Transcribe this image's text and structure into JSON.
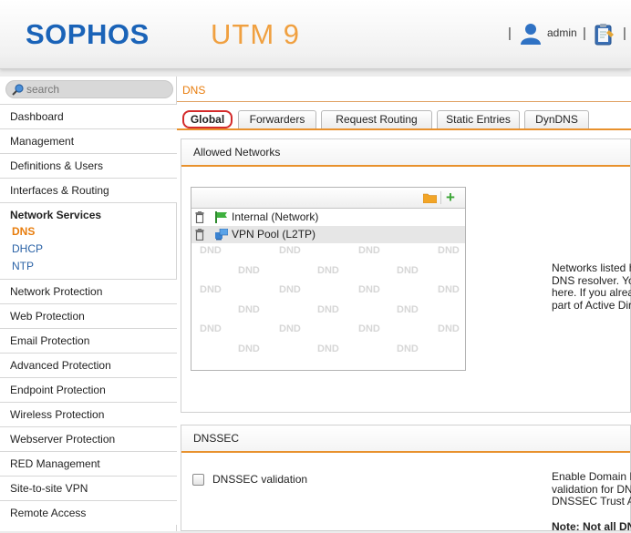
{
  "header": {
    "logo": "SOPHOS",
    "product": "UTM 9",
    "user_name": "admin",
    "separator": "|"
  },
  "search": {
    "placeholder": "search"
  },
  "sidebar": {
    "items_before": [
      "Dashboard",
      "Management",
      "Definitions & Users",
      "Interfaces & Routing"
    ],
    "group": {
      "title": "Network Services",
      "items": [
        "DNS",
        "DHCP",
        "NTP"
      ],
      "active": "DNS"
    },
    "items_after": [
      "Network Protection",
      "Web Protection",
      "Email Protection",
      "Advanced Protection",
      "Endpoint Protection",
      "Wireless Protection",
      "Webserver Protection",
      "RED Management",
      "Site-to-site VPN",
      "Remote Access"
    ]
  },
  "breadcrumb": "DNS",
  "tabs": [
    "Global",
    "Forwarders",
    "Request Routing",
    "Static Entries",
    "DynDNS"
  ],
  "active_tab": "Global",
  "allowed_networks": {
    "title": "Allowed Networks",
    "entries": [
      "Internal (Network)",
      "VPN Pool (L2TP)"
    ],
    "dnd_text": "DND",
    "help_lines": [
      "Networks listed h",
      "DNS resolver. Yo",
      "here. If you alrea",
      "part of Active Dir"
    ]
  },
  "dnssec": {
    "title": "DNSSEC",
    "checkbox_label": "DNSSEC validation",
    "checked": false,
    "help_lines": [
      "Enable Domain N",
      "validation for DN",
      "DNSSEC Trust A"
    ],
    "note": "Note: Not all DN"
  },
  "colors": {
    "brand_blue": "#1a63b8",
    "accent_orange": "#e8912d",
    "active_nav": "#e87d0d",
    "tab_highlight": "#d42b2b"
  }
}
